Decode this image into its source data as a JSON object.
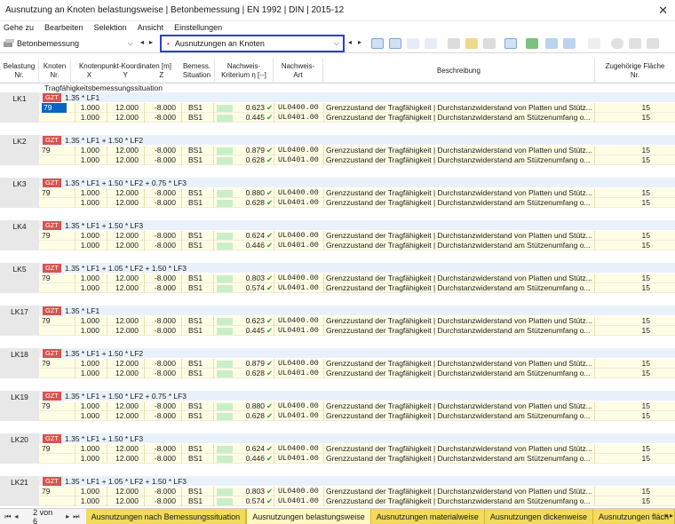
{
  "title": "Ausnutzung an Knoten belastungsweise | Betonbemessung | EN 1992 | DIN | 2015-12",
  "menu": [
    "Gehe zu",
    "Bearbeiten",
    "Selektion",
    "Ansicht",
    "Einstellungen"
  ],
  "toolbar": {
    "module": "Betonbemessung",
    "result_type": "Ausnutzungen an Knoten"
  },
  "headers": {
    "belastung": [
      "Belastung",
      "Nr."
    ],
    "knoten": [
      "Knoten",
      "Nr."
    ],
    "koord_title": "Knotenpunkt-Koordinaten [m]",
    "x": "X",
    "y": "Y",
    "z": "Z",
    "bemess": [
      "Bemess.",
      "Situation"
    ],
    "kriterium": [
      "Nachweis-",
      "Kriterium η [--]"
    ],
    "art": [
      "Nachweis-",
      "Art"
    ],
    "beschreibung": "Beschreibung",
    "flaeche": [
      "Zugehörige Fläche",
      "Nr."
    ]
  },
  "situation_label": "Tragfähigkeitsbemessungssituation",
  "groups": [
    {
      "lk": "LK1",
      "badge": "GZT",
      "combo": "1.35 * LF1",
      "rows": [
        {
          "knoten": "79",
          "x": "1.000",
          "y": "12.000",
          "z": "-8.000",
          "bs": "BS1",
          "eta": "0.623",
          "type": "UL0400.00",
          "desc": "Grenzzustand der Tragfähigkeit | Durchstanzwiderstand von Platten und Stütz...",
          "area": "15"
        },
        {
          "knoten": "",
          "x": "1.000",
          "y": "12.000",
          "z": "-8.000",
          "bs": "BS1",
          "eta": "0.445",
          "type": "UL0401.00",
          "desc": "Grenzzustand der Tragfähigkeit | Durchstanzwiderstand am Stützenumfang o...",
          "area": "15"
        }
      ]
    },
    {
      "lk": "LK2",
      "badge": "GZT",
      "combo": "1.35 * LF1 + 1.50 * LF2",
      "rows": [
        {
          "knoten": "79",
          "x": "1.000",
          "y": "12.000",
          "z": "-8.000",
          "bs": "BS1",
          "eta": "0.879",
          "type": "UL0400.00",
          "desc": "Grenzzustand der Tragfähigkeit | Durchstanzwiderstand von Platten und Stütz...",
          "area": "15"
        },
        {
          "knoten": "",
          "x": "1.000",
          "y": "12.000",
          "z": "-8.000",
          "bs": "BS1",
          "eta": "0.628",
          "type": "UL0401.00",
          "desc": "Grenzzustand der Tragfähigkeit | Durchstanzwiderstand am Stützenumfang o...",
          "area": "15"
        }
      ]
    },
    {
      "lk": "LK3",
      "badge": "GZT",
      "combo": "1.35 * LF1 + 1.50 * LF2 + 0.75 * LF3",
      "rows": [
        {
          "knoten": "79",
          "x": "1.000",
          "y": "12.000",
          "z": "-8.000",
          "bs": "BS1",
          "eta": "0.880",
          "type": "UL0400.00",
          "desc": "Grenzzustand der Tragfähigkeit | Durchstanzwiderstand von Platten und Stütz...",
          "area": "15"
        },
        {
          "knoten": "",
          "x": "1.000",
          "y": "12.000",
          "z": "-8.000",
          "bs": "BS1",
          "eta": "0.628",
          "type": "UL0401.00",
          "desc": "Grenzzustand der Tragfähigkeit | Durchstanzwiderstand am Stützenumfang o...",
          "area": "15"
        }
      ]
    },
    {
      "lk": "LK4",
      "badge": "GZT",
      "combo": "1.35 * LF1 + 1.50 * LF3",
      "rows": [
        {
          "knoten": "79",
          "x": "1.000",
          "y": "12.000",
          "z": "-8.000",
          "bs": "BS1",
          "eta": "0.624",
          "type": "UL0400.00",
          "desc": "Grenzzustand der Tragfähigkeit | Durchstanzwiderstand von Platten und Stütz...",
          "area": "15"
        },
        {
          "knoten": "",
          "x": "1.000",
          "y": "12.000",
          "z": "-8.000",
          "bs": "BS1",
          "eta": "0.446",
          "type": "UL0401.00",
          "desc": "Grenzzustand der Tragfähigkeit | Durchstanzwiderstand am Stützenumfang o...",
          "area": "15"
        }
      ]
    },
    {
      "lk": "LK5",
      "badge": "GZT",
      "combo": "1.35 * LF1 + 1.05 * LF2 + 1.50 * LF3",
      "rows": [
        {
          "knoten": "79",
          "x": "1.000",
          "y": "12.000",
          "z": "-8.000",
          "bs": "BS1",
          "eta": "0.803",
          "type": "UL0400.00",
          "desc": "Grenzzustand der Tragfähigkeit | Durchstanzwiderstand von Platten und Stütz...",
          "area": "15"
        },
        {
          "knoten": "",
          "x": "1.000",
          "y": "12.000",
          "z": "-8.000",
          "bs": "BS1",
          "eta": "0.574",
          "type": "UL0401.00",
          "desc": "Grenzzustand der Tragfähigkeit | Durchstanzwiderstand am Stützenumfang o...",
          "area": "15"
        }
      ]
    },
    {
      "lk": "LK17",
      "badge": "GZT",
      "combo": "1.35 * LF1",
      "rows": [
        {
          "knoten": "79",
          "x": "1.000",
          "y": "12.000",
          "z": "-8.000",
          "bs": "BS1",
          "eta": "0.623",
          "type": "UL0400.00",
          "desc": "Grenzzustand der Tragfähigkeit | Durchstanzwiderstand von Platten und Stütz...",
          "area": "15"
        },
        {
          "knoten": "",
          "x": "1.000",
          "y": "12.000",
          "z": "-8.000",
          "bs": "BS1",
          "eta": "0.445",
          "type": "UL0401.00",
          "desc": "Grenzzustand der Tragfähigkeit | Durchstanzwiderstand am Stützenumfang o...",
          "area": "15"
        }
      ]
    },
    {
      "lk": "LK18",
      "badge": "GZT",
      "combo": "1.35 * LF1 + 1.50 * LF2",
      "rows": [
        {
          "knoten": "79",
          "x": "1.000",
          "y": "12.000",
          "z": "-8.000",
          "bs": "BS1",
          "eta": "0.879",
          "type": "UL0400.00",
          "desc": "Grenzzustand der Tragfähigkeit | Durchstanzwiderstand von Platten und Stütz...",
          "area": "15"
        },
        {
          "knoten": "",
          "x": "1.000",
          "y": "12.000",
          "z": "-8.000",
          "bs": "BS1",
          "eta": "0.628",
          "type": "UL0401.00",
          "desc": "Grenzzustand der Tragfähigkeit | Durchstanzwiderstand am Stützenumfang o...",
          "area": "15"
        }
      ]
    },
    {
      "lk": "LK19",
      "badge": "GZT",
      "combo": "1.35 * LF1 + 1.50 * LF2 + 0.75 * LF3",
      "rows": [
        {
          "knoten": "79",
          "x": "1.000",
          "y": "12.000",
          "z": "-8.000",
          "bs": "BS1",
          "eta": "0.880",
          "type": "UL0400.00",
          "desc": "Grenzzustand der Tragfähigkeit | Durchstanzwiderstand von Platten und Stütz...",
          "area": "15"
        },
        {
          "knoten": "",
          "x": "1.000",
          "y": "12.000",
          "z": "-8.000",
          "bs": "BS1",
          "eta": "0.628",
          "type": "UL0401.00",
          "desc": "Grenzzustand der Tragfähigkeit | Durchstanzwiderstand am Stützenumfang o...",
          "area": "15"
        }
      ]
    },
    {
      "lk": "LK20",
      "badge": "GZT",
      "combo": "1.35 * LF1 + 1.50 * LF3",
      "rows": [
        {
          "knoten": "79",
          "x": "1.000",
          "y": "12.000",
          "z": "-8.000",
          "bs": "BS1",
          "eta": "0.624",
          "type": "UL0400.00",
          "desc": "Grenzzustand der Tragfähigkeit | Durchstanzwiderstand von Platten und Stütz...",
          "area": "15"
        },
        {
          "knoten": "",
          "x": "1.000",
          "y": "12.000",
          "z": "-8.000",
          "bs": "BS1",
          "eta": "0.446",
          "type": "UL0401.00",
          "desc": "Grenzzustand der Tragfähigkeit | Durchstanzwiderstand am Stützenumfang o...",
          "area": "15"
        }
      ]
    },
    {
      "lk": "LK21",
      "badge": "GZT",
      "combo": "1.35 * LF1 + 1.05 * LF2 + 1.50 * LF3",
      "rows": [
        {
          "knoten": "79",
          "x": "1.000",
          "y": "12.000",
          "z": "-8.000",
          "bs": "BS1",
          "eta": "0.803",
          "type": "UL0400.00",
          "desc": "Grenzzustand der Tragfähigkeit | Durchstanzwiderstand von Platten und Stütz...",
          "area": "15"
        },
        {
          "knoten": "",
          "x": "1.000",
          "y": "12.000",
          "z": "-8.000",
          "bs": "BS1",
          "eta": "0.574",
          "type": "UL0401.00",
          "desc": "Grenzzustand der Tragfähigkeit | Durchstanzwiderstand am Stützenumfang o...",
          "area": "15"
        }
      ]
    }
  ],
  "status": {
    "page": "2 von 6",
    "tabs": [
      "Ausnutzungen nach Bemessungssituation",
      "Ausnutzungen belastungsweise",
      "Ausnutzungen materialweise",
      "Ausnutzungen dickenweise",
      "Ausnutzungen fläch"
    ],
    "active_tab": 1
  },
  "colors": {
    "gzt_badge": "#d9534f",
    "combo_row": "#e9f2fb",
    "data_row": "#fffde6",
    "tab": "#f2da5a",
    "highlight_border": "#2a3fd0"
  }
}
